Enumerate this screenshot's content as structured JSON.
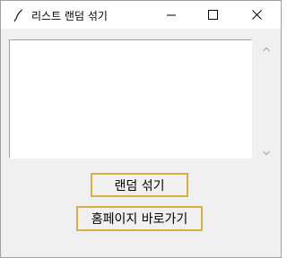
{
  "window": {
    "title": "리스트 랜덤 섞기",
    "icon": "feather-icon",
    "controls": {
      "minimize_icon": "minimize-icon",
      "maximize_icon": "maximize-icon",
      "close_icon": "close-icon"
    }
  },
  "listbox": {
    "items": []
  },
  "buttons": {
    "shuffle_label": "랜덤 섞기",
    "homepage_label": "홈페이지 바로가기"
  },
  "colors": {
    "button_border": "#d8b040",
    "window_bg": "#f0f0f0",
    "titlebar_bg": "#ffffff"
  }
}
